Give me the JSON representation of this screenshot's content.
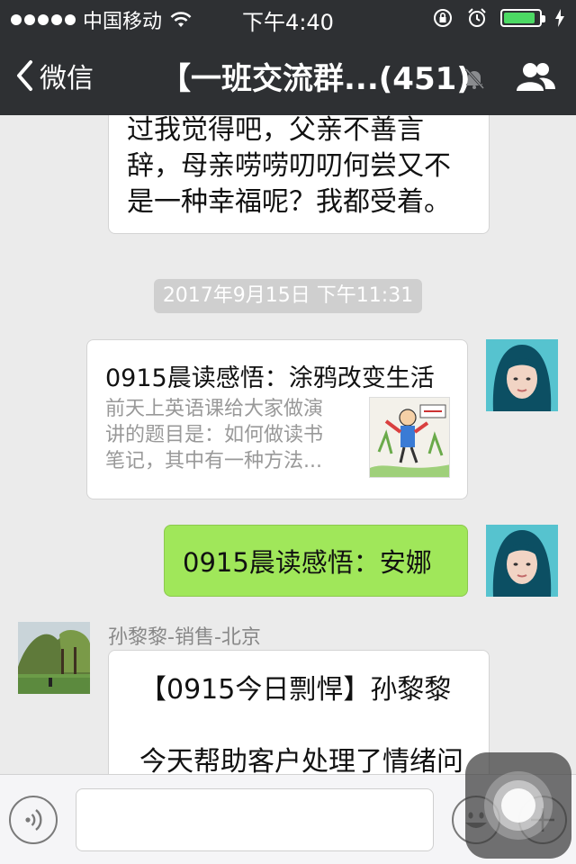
{
  "status_bar": {
    "carrier": "中国移动",
    "time": "下午4:40",
    "battery_level": 0.85
  },
  "nav": {
    "back_label": "微信",
    "title": "【一班交流群...(451)"
  },
  "messages": {
    "prev_bubble_lines": [
      "过我觉得吧，父亲不善言",
      "辞，母亲唠唠叨叨何尝又不",
      "是一种幸福呢？我都受着。"
    ],
    "timestamp": "2017年9月15日 下午11:31",
    "link_card": {
      "title": "0915晨读感悟：涂鸦改变生活",
      "desc": "前天上英语课给大家做演讲的题目是：如何做读书笔记，其中有一种方法..."
    },
    "sent_text": "0915晨读感悟：安娜",
    "sender_name": "孙黎黎-销售-北京",
    "incoming_lines": [
      "【0915今日剽悍】孙黎黎",
      "",
      "今天帮助客户处理了情绪问"
    ]
  },
  "colors": {
    "bar_bg": "#2e3033",
    "chat_bg": "#ebebeb",
    "green_bubble": "#a0e75a",
    "battery_green": "#4cd964"
  },
  "icons": [
    "wifi-icon",
    "lock-rotation-icon",
    "alarm-icon",
    "battery-icon",
    "back-chevron-icon",
    "mute-bell-icon",
    "group-members-icon",
    "voice-icon",
    "emoji-icon",
    "plus-icon",
    "assistive-touch-icon"
  ]
}
